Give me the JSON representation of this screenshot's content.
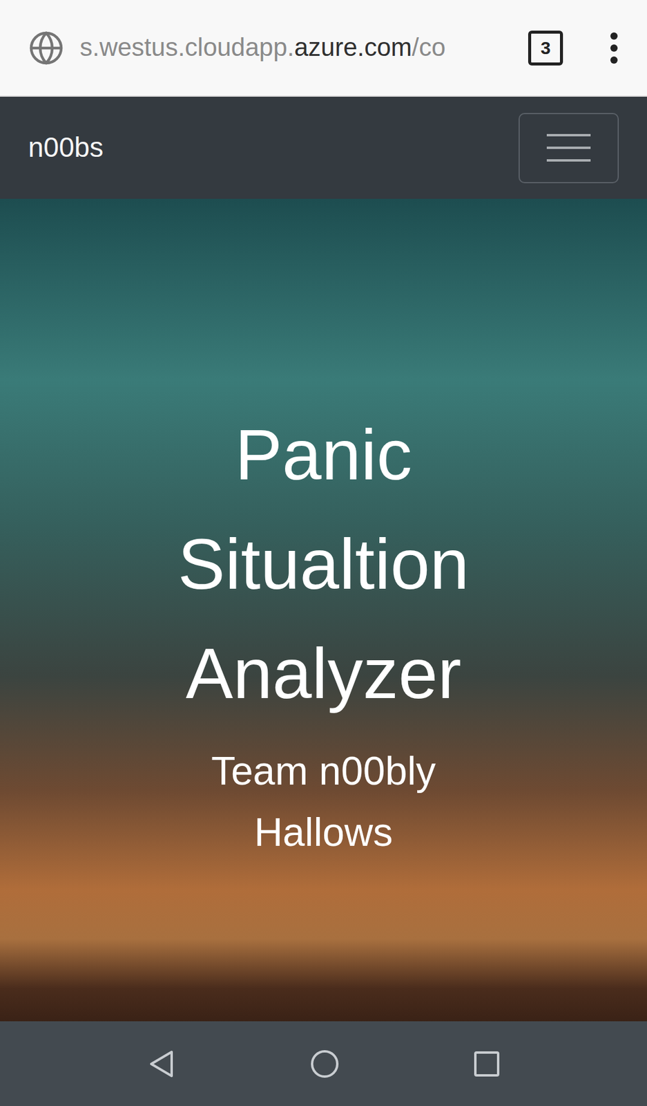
{
  "browser": {
    "url": [
      {
        "text": "s.westus.cloudapp.",
        "emphasis": false
      },
      {
        "text": "azure.com",
        "emphasis": true
      },
      {
        "text": "/co",
        "emphasis": false
      }
    ],
    "tab_count": "3"
  },
  "navbar": {
    "brand": "n00bs",
    "menu_expanded": false
  },
  "hero": {
    "title": "Panic Situaltion Analyzer",
    "subtitle": "Team n00bly Hallows"
  }
}
